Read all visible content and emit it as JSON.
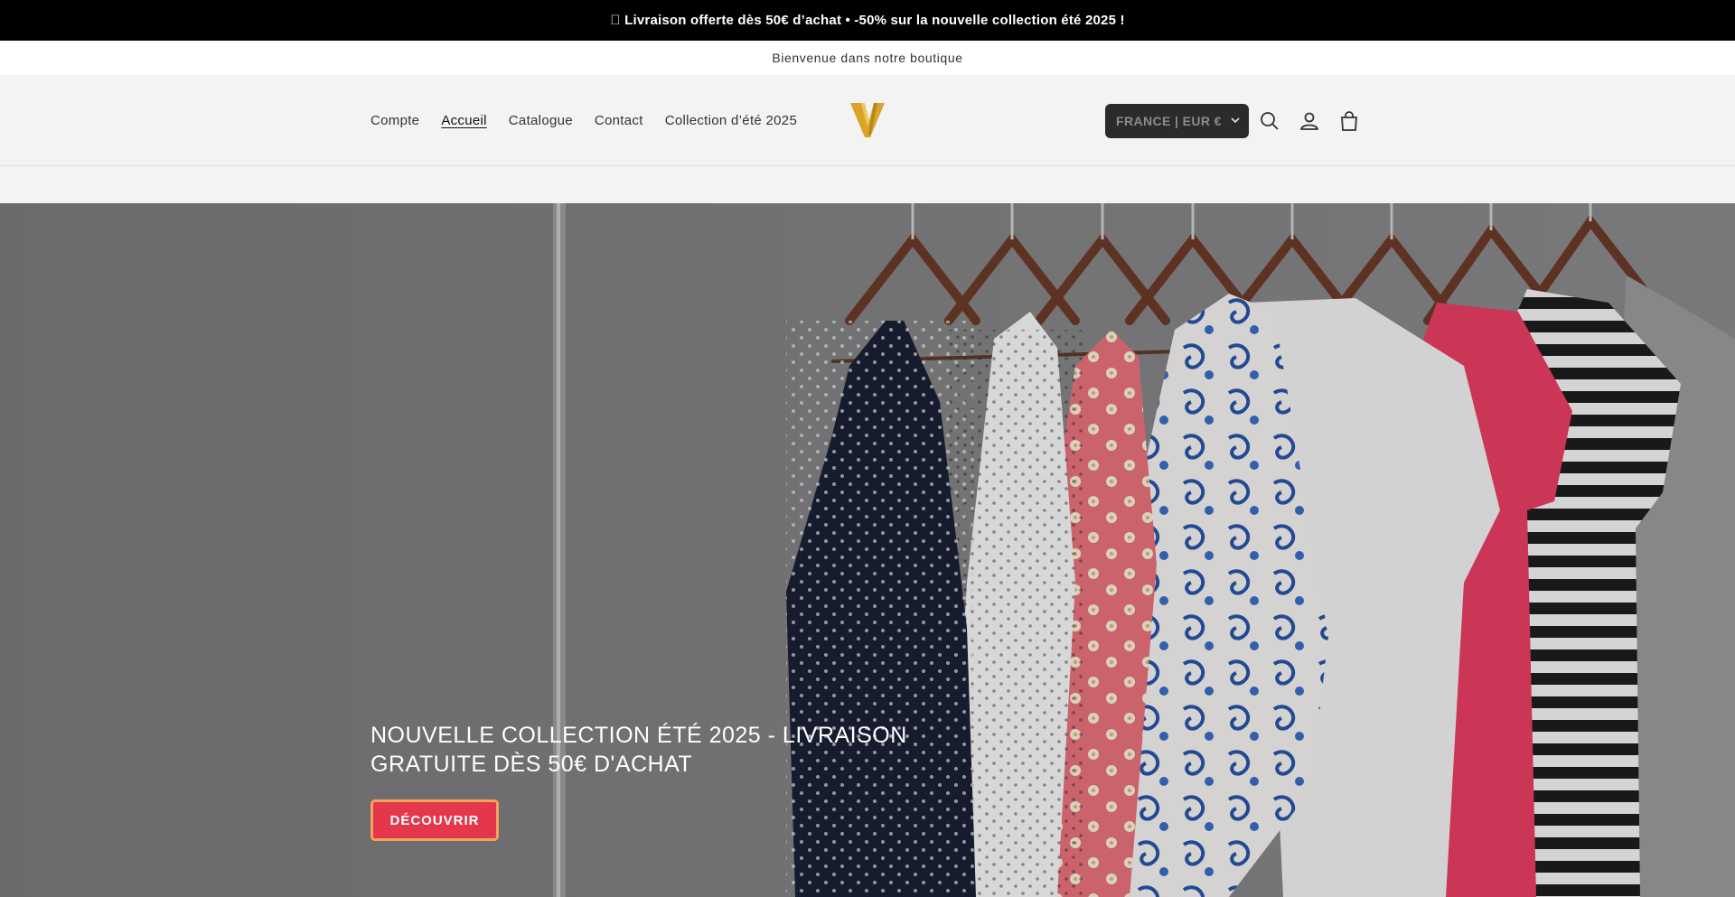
{
  "announcement": {
    "text": "\u0000 Livraison offerte dès 50€ d’achat • -50% sur la nouvelle collection été 2025 !"
  },
  "welcome_bar": {
    "text": "Bienvenue dans notre boutique"
  },
  "header": {
    "nav": [
      {
        "label": "Compte",
        "active": false
      },
      {
        "label": "Accueil",
        "active": true
      },
      {
        "label": "Catalogue",
        "active": false
      },
      {
        "label": "Contact",
        "active": false
      },
      {
        "label": "Collection d’été 2025",
        "active": false
      }
    ],
    "logo_icon": "v-monogram-logo",
    "country_selector": {
      "value": "FRANCE | EUR €"
    },
    "icons": [
      "search-icon",
      "account-icon",
      "cart-icon"
    ]
  },
  "hero": {
    "title": "NOUVELLE COLLECTION ÉTÉ 2025 - LIVRAISON GRATUITE DÈS 50€ D'ACHAT",
    "cta_label": "DÉCOUVRIR"
  },
  "colors": {
    "announcement_bg": "#000000",
    "header_bg": "#f3f3f3",
    "logo_gold": "#d9a528",
    "country_bg": "#2b2b2b",
    "cta_bg": "#e5374b",
    "cta_border": "#f5a25a"
  }
}
